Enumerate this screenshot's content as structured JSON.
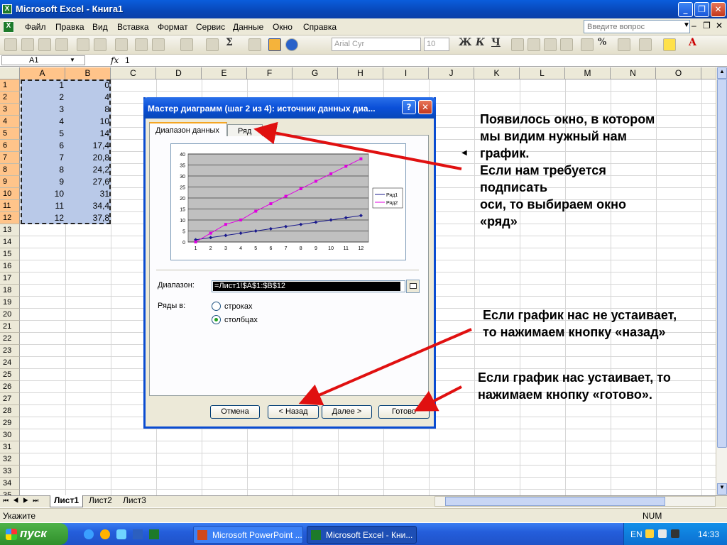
{
  "window": {
    "title": "Microsoft Excel - Книга1"
  },
  "menu": [
    "Файл",
    "Правка",
    "Вид",
    "Вставка",
    "Формат",
    "Сервис",
    "Данные",
    "Окно",
    "Справка"
  ],
  "help_box": {
    "placeholder": "Введите вопрос"
  },
  "toolbar": {
    "font_name": "Arial Cyr",
    "font_size": "10",
    "bold": "Ж",
    "italic": "К",
    "underline": "Ч"
  },
  "formula_bar": {
    "cell_ref": "A1",
    "fx": "fx",
    "value": "1"
  },
  "columns": [
    "A",
    "B",
    "C",
    "D",
    "E",
    "F",
    "G",
    "H",
    "I",
    "J",
    "K",
    "L",
    "M",
    "N",
    "O"
  ],
  "rows": [
    "1",
    "2",
    "3",
    "4",
    "5",
    "6",
    "7",
    "8",
    "9",
    "10",
    "11",
    "12",
    "13",
    "14",
    "15",
    "16",
    "17",
    "18",
    "19",
    "20",
    "21",
    "22",
    "23",
    "24",
    "25",
    "26",
    "27",
    "28",
    "29",
    "30",
    "31",
    "32",
    "33",
    "34",
    "35"
  ],
  "cells": {
    "A": [
      "1",
      "2",
      "3",
      "4",
      "5",
      "6",
      "7",
      "8",
      "9",
      "10",
      "11",
      "12"
    ],
    "B": [
      "0",
      "4",
      "8",
      "10",
      "14",
      "17,4",
      "20,8",
      "24,2",
      "27,6",
      "31",
      "34,4",
      "37,8"
    ]
  },
  "sheets": [
    "Лист1",
    "Лист2",
    "Лист3"
  ],
  "status": {
    "left": "Укажите",
    "num": "NUM"
  },
  "taskbar": {
    "start": "пуск",
    "tasks": [
      "Microsoft PowerPoint ...",
      "Microsoft Excel - Кни..."
    ],
    "lang": "EN",
    "clock": "14:33"
  },
  "dialog": {
    "title": "Мастер диаграмм (шаг 2 из 4): источник данных диа...",
    "tabs": [
      "Диапазон данных",
      "Ряд"
    ],
    "range_label": "Диапазон:",
    "range_value": "=Лист1!$A$1:$B$12",
    "series_in_label": "Ряды в:",
    "radio_rows": "строках",
    "radio_cols": "столбцах",
    "buttons": {
      "cancel": "Отмена",
      "back": "< Назад",
      "next": "Далее >",
      "finish": "Готово"
    }
  },
  "chart_data": {
    "type": "line",
    "x": [
      1,
      2,
      3,
      4,
      5,
      6,
      7,
      8,
      9,
      10,
      11,
      12
    ],
    "ylim": [
      0,
      40
    ],
    "yticks": [
      0,
      5,
      10,
      15,
      20,
      25,
      30,
      35,
      40
    ],
    "series": [
      {
        "name": "Ряд1",
        "values": [
          1,
          2,
          3,
          4,
          5,
          6,
          7,
          8,
          9,
          10,
          11,
          12
        ],
        "color": "#1a1a8c"
      },
      {
        "name": "Ряд2",
        "values": [
          0,
          4,
          8,
          10,
          14,
          17.4,
          20.8,
          24.2,
          27.6,
          31,
          34.4,
          37.8
        ],
        "color": "#e000e0"
      }
    ],
    "legend": "right",
    "plot_bg": "#c0c0c0"
  },
  "annotations": {
    "top": [
      "Появилось окно, в котором",
      "мы видим нужный нам",
      "график.",
      "Если нам требуется",
      "подписать",
      "оси, то выбираем окно",
      "«ряд»"
    ],
    "middle": [
      "Если график нас не устаивает,",
      "то нажимаем кнопку «назад»"
    ],
    "bottom": [
      "Если график нас устаивает, то",
      "нажимаем  кнопку «готово»."
    ]
  }
}
